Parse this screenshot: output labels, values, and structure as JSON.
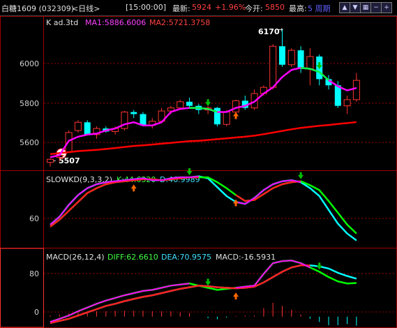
{
  "header": {
    "name_code": "白糖1609 (032309)",
    "period": "<日线>",
    "time": "[15:00:00]",
    "latest_label": "最新:",
    "latest_value": "5924",
    "change": "+1.96%",
    "open_label": "今开:",
    "open_value": "5850",
    "high_label": "最高:",
    "period_btn_label": "5 周期",
    "buttons": [
      "up-arrow-icon",
      "down-arrow-icon",
      "grid-icon",
      "zoom-out-icon",
      "zoom-in-icon",
      "close-icon"
    ]
  },
  "colors": {
    "border": "#a00000",
    "candle_up": "#ff3232",
    "candle_down": "#00ffff",
    "ma1": "#ff00ff",
    "ma2": "#ff0000",
    "k_line": "#00ffff",
    "d_line": "#00ff00",
    "buy_arrow": "#ff6600",
    "sell_arrow": "#00c000"
  },
  "chart_data": [
    {
      "type": "candlestick",
      "legend": "K  ad.3td",
      "ma1_label": "MA1:5886.6006",
      "ma2_label": "MA2:5721.3758",
      "y_ticks": [
        "6000",
        "5800",
        "5600"
      ],
      "y_tick_values": [
        6000,
        5800,
        5600
      ],
      "ylim": [
        5490,
        6230
      ],
      "annotations": [
        {
          "text": "6170",
          "value": 6170
        },
        {
          "text": "5507",
          "value": 5507
        }
      ],
      "candles": [
        {
          "o": 5525,
          "h": 5545,
          "l": 5505,
          "c": 5540
        },
        {
          "o": 5550,
          "h": 5565,
          "l": 5530,
          "c": 5560
        },
        {
          "o": 5575,
          "h": 5680,
          "l": 5570,
          "c": 5670
        },
        {
          "o": 5680,
          "h": 5730,
          "l": 5670,
          "c": 5720
        },
        {
          "o": 5720,
          "h": 5730,
          "l": 5660,
          "c": 5660
        },
        {
          "o": 5660,
          "h": 5700,
          "l": 5640,
          "c": 5690
        },
        {
          "o": 5690,
          "h": 5700,
          "l": 5670,
          "c": 5675
        },
        {
          "o": 5675,
          "h": 5700,
          "l": 5660,
          "c": 5690
        },
        {
          "o": 5690,
          "h": 5775,
          "l": 5680,
          "c": 5770
        },
        {
          "o": 5770,
          "h": 5780,
          "l": 5740,
          "c": 5760
        },
        {
          "o": 5760,
          "h": 5770,
          "l": 5700,
          "c": 5705
        },
        {
          "o": 5705,
          "h": 5740,
          "l": 5690,
          "c": 5725
        },
        {
          "o": 5725,
          "h": 5790,
          "l": 5715,
          "c": 5775
        },
        {
          "o": 5775,
          "h": 5800,
          "l": 5760,
          "c": 5790
        },
        {
          "o": 5790,
          "h": 5830,
          "l": 5780,
          "c": 5820
        },
        {
          "o": 5820,
          "h": 5840,
          "l": 5790,
          "c": 5800
        },
        {
          "o": 5800,
          "h": 5810,
          "l": 5760,
          "c": 5780
        },
        {
          "o": 5780,
          "h": 5800,
          "l": 5760,
          "c": 5790
        },
        {
          "o": 5790,
          "h": 5795,
          "l": 5700,
          "c": 5710
        },
        {
          "o": 5710,
          "h": 5780,
          "l": 5700,
          "c": 5770
        },
        {
          "o": 5770,
          "h": 5830,
          "l": 5760,
          "c": 5825
        },
        {
          "o": 5825,
          "h": 5850,
          "l": 5780,
          "c": 5790
        },
        {
          "o": 5790,
          "h": 5880,
          "l": 5780,
          "c": 5860
        },
        {
          "o": 5860,
          "h": 5900,
          "l": 5850,
          "c": 5890
        },
        {
          "o": 5890,
          "h": 6100,
          "l": 5880,
          "c": 6090
        },
        {
          "o": 6090,
          "h": 6170,
          "l": 5990,
          "c": 6000
        },
        {
          "o": 6000,
          "h": 6080,
          "l": 5990,
          "c": 6070
        },
        {
          "o": 6070,
          "h": 6090,
          "l": 5960,
          "c": 5980
        },
        {
          "o": 5980,
          "h": 6080,
          "l": 5900,
          "c": 6040
        },
        {
          "o": 6040,
          "h": 6050,
          "l": 5900,
          "c": 5930
        },
        {
          "o": 5930,
          "h": 5950,
          "l": 5880,
          "c": 5900
        },
        {
          "o": 5900,
          "h": 5920,
          "l": 5790,
          "c": 5800
        },
        {
          "o": 5800,
          "h": 5850,
          "l": 5760,
          "c": 5830
        },
        {
          "o": 5830,
          "h": 5960,
          "l": 5820,
          "c": 5924
        }
      ],
      "ma1": [
        5550,
        5560,
        5630,
        5650,
        5660,
        5665,
        5680,
        5690,
        5710,
        5720,
        5705,
        5705,
        5720,
        5770,
        5785,
        5790,
        5790,
        5785,
        5770,
        5770,
        5790,
        5800,
        5820,
        5860,
        5890,
        5940,
        5975,
        5985,
        5980,
        5965,
        5925,
        5895,
        5875,
        5887
      ],
      "ma2": [
        5565,
        5570,
        5575,
        5580,
        5583,
        5586,
        5590,
        5595,
        5600,
        5605,
        5608,
        5612,
        5616,
        5620,
        5624,
        5628,
        5630,
        5634,
        5638,
        5642,
        5646,
        5650,
        5655,
        5662,
        5670,
        5678,
        5686,
        5693,
        5698,
        5703,
        5707,
        5712,
        5716,
        5721
      ],
      "buy_signals": [
        20
      ],
      "sell_signals": [
        17,
        29
      ]
    },
    {
      "type": "line",
      "legend": "SLOWKD(9,3,3,2)",
      "k_label": "K:44.6320",
      "d_label": "D:46.9989",
      "y_ticks": [
        "60"
      ],
      "y_tick_values": [
        60
      ],
      "ylim": [
        25,
        100
      ],
      "k": [
        47,
        55,
        67,
        77,
        84,
        88,
        90,
        91,
        92,
        93,
        94,
        92,
        92,
        94,
        95,
        95,
        96,
        94,
        85,
        76,
        70,
        68,
        74,
        82,
        88,
        91,
        92,
        90,
        84,
        76,
        62,
        48,
        38,
        31
      ],
      "d": [
        45,
        52,
        61,
        70,
        79,
        84,
        88,
        90,
        91,
        92,
        93,
        93,
        92,
        93,
        94,
        95,
        95,
        95,
        90,
        84,
        77,
        71,
        72,
        78,
        84,
        88,
        90,
        91,
        87,
        82,
        71,
        59,
        47,
        38
      ],
      "buy_signals": [
        9,
        20
      ],
      "sell_signals": [
        15,
        27
      ]
    },
    {
      "type": "line",
      "legend": "MACD(26,12,4)",
      "diff_label": "DIFF:62.6610",
      "dea_label": "DEA:70.9575",
      "macd_label": "MACD:-16.5931",
      "y_ticks": [
        "80",
        "0"
      ],
      "y_tick_values": [
        80,
        0
      ],
      "ylim": [
        -20,
        125
      ],
      "diff": [
        -10,
        -4,
        2,
        10,
        17,
        24,
        30,
        35,
        40,
        44,
        48,
        50,
        54,
        58,
        60,
        62,
        58,
        54,
        50,
        52,
        54,
        56,
        58,
        80,
        100,
        104,
        105,
        100,
        92,
        84,
        74,
        66,
        62,
        63
      ],
      "dea": [
        -12,
        -8,
        -4,
        2,
        8,
        14,
        20,
        24,
        29,
        33,
        37,
        40,
        44,
        48,
        52,
        55,
        58,
        57,
        55,
        54,
        53,
        54,
        56,
        64,
        74,
        84,
        92,
        96,
        96,
        94,
        90,
        82,
        76,
        71
      ],
      "macd": [
        2,
        4,
        6,
        8,
        9,
        10,
        10,
        11,
        11,
        11,
        11,
        10,
        10,
        10,
        8,
        7,
        0,
        -3,
        -5,
        -2,
        1,
        2,
        2,
        16,
        26,
        20,
        13,
        4,
        -4,
        -10,
        -16,
        -16,
        -14,
        -17
      ],
      "buy_signals": [
        20
      ],
      "sell_signals": [
        17,
        29
      ]
    }
  ]
}
